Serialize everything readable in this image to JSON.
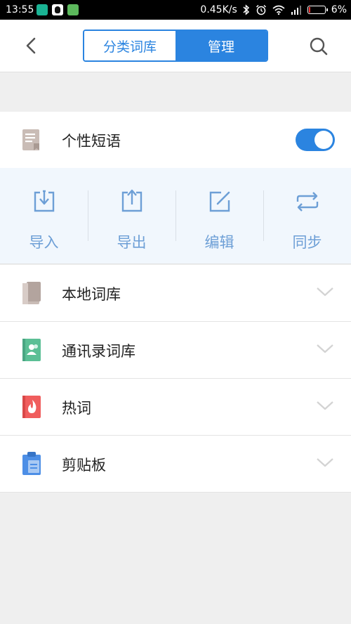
{
  "status_bar": {
    "time": "13:55",
    "network_speed": "0.45K/s",
    "battery_percent": "6%",
    "icons": [
      "app-notification-icon",
      "qq-icon",
      "wechat-icon",
      "bluetooth-icon",
      "alarm-icon",
      "wifi-icon",
      "signal-icon",
      "battery-icon"
    ]
  },
  "header": {
    "back_icon": "chevron-left-icon",
    "tabs": [
      {
        "label": "分类词库",
        "active": false
      },
      {
        "label": "管理",
        "active": true
      }
    ],
    "search_icon": "search-icon",
    "accent_color": "#2b84e0"
  },
  "phrase": {
    "label": "个性短语",
    "enabled": true,
    "icon": "document-bookmark-icon"
  },
  "actions": [
    {
      "label": "导入",
      "icon": "import-icon"
    },
    {
      "label": "导出",
      "icon": "export-icon"
    },
    {
      "label": "编辑",
      "icon": "edit-icon"
    },
    {
      "label": "同步",
      "icon": "sync-icon"
    }
  ],
  "list": [
    {
      "label": "本地词库",
      "icon": "book-icon",
      "color": "#c9bcb6"
    },
    {
      "label": "通讯录词库",
      "icon": "contacts-book-icon",
      "color": "#5bbf95"
    },
    {
      "label": "热词",
      "icon": "fire-icon",
      "color": "#f05d5d"
    },
    {
      "label": "剪贴板",
      "icon": "clipboard-icon",
      "color": "#4d8fe6"
    }
  ]
}
